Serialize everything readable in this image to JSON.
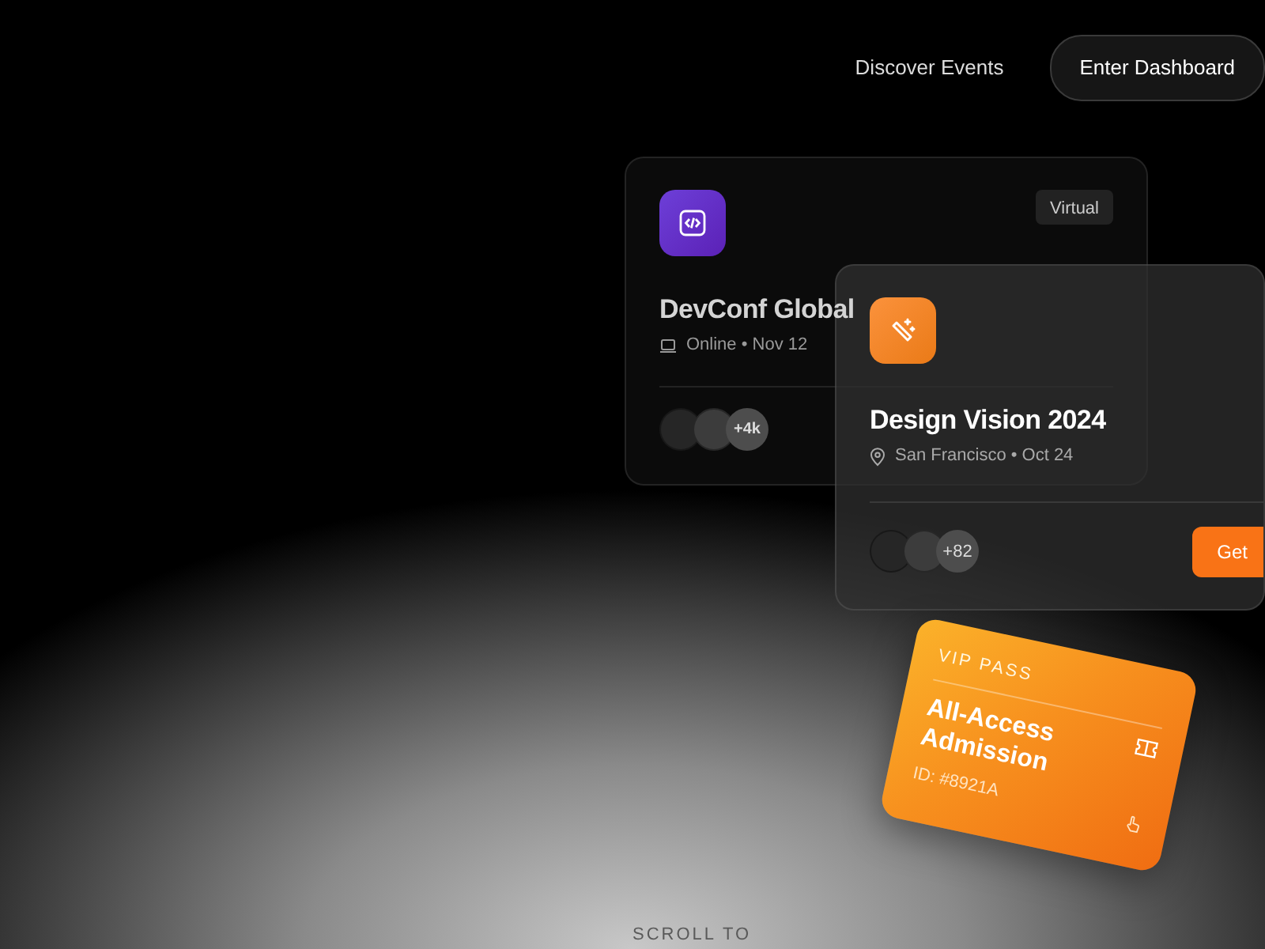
{
  "nav": {
    "links": [
      "Discover Events"
    ],
    "button": "Enter Dashboard"
  },
  "events": [
    {
      "kind": "code",
      "badge": "Virtual",
      "title": "DevConf Global",
      "meta": "Online • Nov 12",
      "extra_count": "+4k"
    },
    {
      "kind": "design",
      "title": "Design Vision 2024",
      "meta": "San Francisco • Oct 24",
      "extra_count": "+82",
      "button": "Get"
    }
  ],
  "pass": {
    "label": "VIP PASS",
    "title": "All-Access Admission",
    "id": "ID: #8921A"
  },
  "scroll_hint": "SCROLL TO"
}
